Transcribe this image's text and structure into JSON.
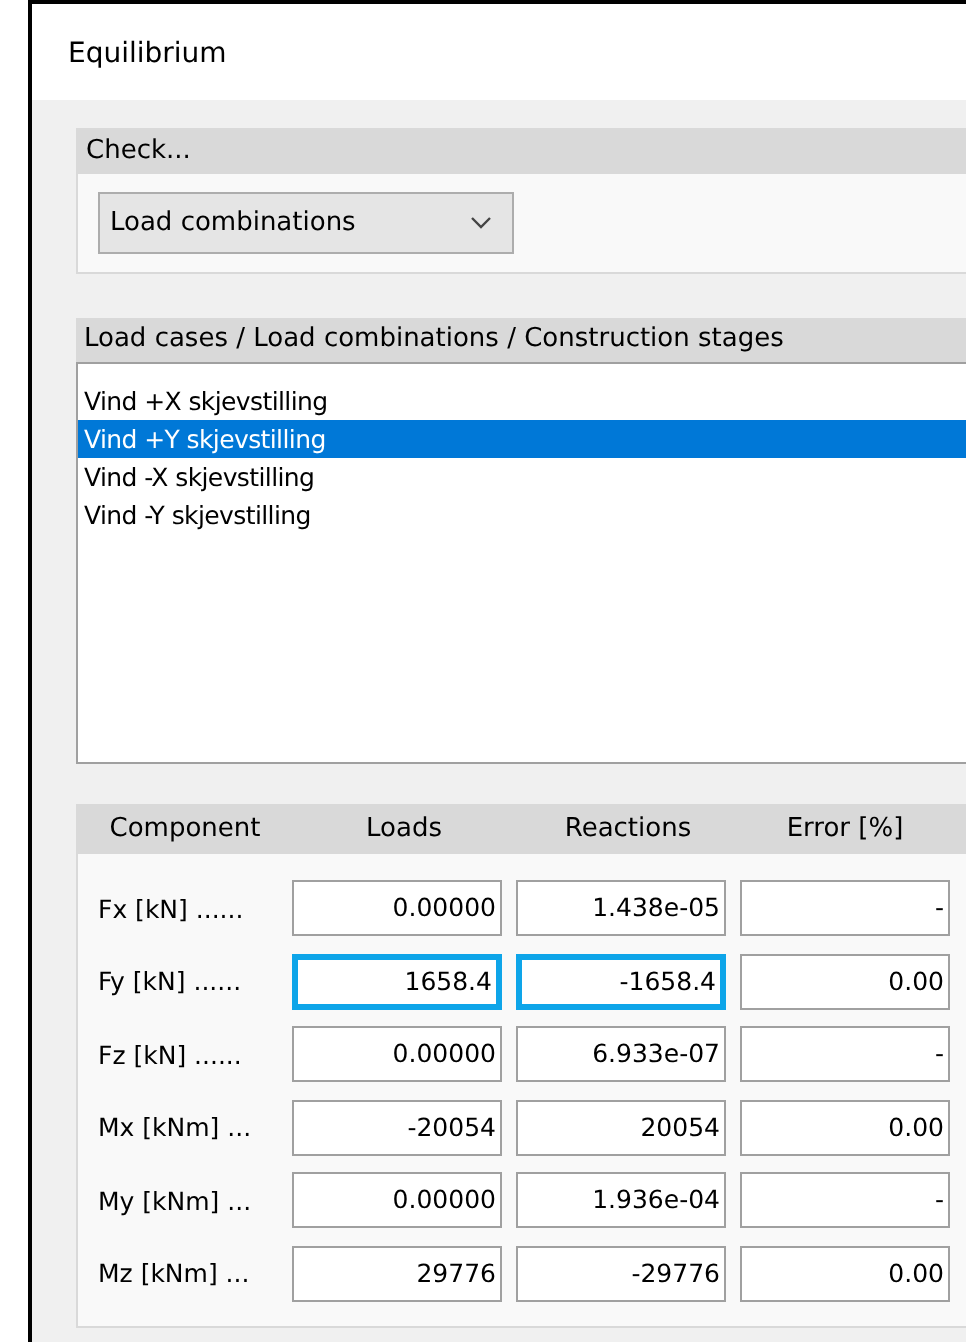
{
  "window": {
    "title": "Equilibrium"
  },
  "check": {
    "title": "Check...",
    "dropdown": {
      "value": "Load combinations"
    }
  },
  "cases": {
    "title": "Load cases / Load combinations / Construction stages",
    "items": [
      {
        "label": "Vind +X skjevstilling",
        "selected": false
      },
      {
        "label": "Vind +Y skjevstilling",
        "selected": true
      },
      {
        "label": "Vind -X skjevstilling",
        "selected": false
      },
      {
        "label": "Vind -Y skjevstilling",
        "selected": false
      }
    ]
  },
  "results": {
    "columns": [
      "Component",
      "Loads",
      "Reactions",
      "Error [%]"
    ],
    "rows": [
      {
        "cells": [
          {
            "kind": "label",
            "value": "Fx [kN] ......"
          },
          {
            "kind": "field",
            "value": "0.00000",
            "highlighted": false
          },
          {
            "kind": "field",
            "value": "1.438e-05",
            "highlighted": false
          },
          {
            "kind": "field",
            "value": "-",
            "highlighted": false
          }
        ]
      },
      {
        "cells": [
          {
            "kind": "label",
            "value": "Fy [kN] ......"
          },
          {
            "kind": "field",
            "value": "1658.4",
            "highlighted": true
          },
          {
            "kind": "field",
            "value": "-1658.4",
            "highlighted": true
          },
          {
            "kind": "field",
            "value": "0.00",
            "highlighted": false
          }
        ]
      },
      {
        "cells": [
          {
            "kind": "label",
            "value": "Fz [kN] ......"
          },
          {
            "kind": "field",
            "value": "0.00000",
            "highlighted": false
          },
          {
            "kind": "field",
            "value": "6.933e-07",
            "highlighted": false
          },
          {
            "kind": "field",
            "value": "-",
            "highlighted": false
          }
        ]
      },
      {
        "cells": [
          {
            "kind": "label",
            "value": "Mx [kNm] ..."
          },
          {
            "kind": "field",
            "value": "-20054",
            "highlighted": false
          },
          {
            "kind": "field",
            "value": "20054",
            "highlighted": false
          },
          {
            "kind": "field",
            "value": "0.00",
            "highlighted": false
          }
        ]
      },
      {
        "cells": [
          {
            "kind": "label",
            "value": "My [kNm] ..."
          },
          {
            "kind": "field",
            "value": "0.00000",
            "highlighted": false
          },
          {
            "kind": "field",
            "value": "1.936e-04",
            "highlighted": false
          },
          {
            "kind": "field",
            "value": "-",
            "highlighted": false
          }
        ]
      },
      {
        "cells": [
          {
            "kind": "label",
            "value": "Mz [kNm] ..."
          },
          {
            "kind": "field",
            "value": "29776",
            "highlighted": false
          },
          {
            "kind": "field",
            "value": "-29776",
            "highlighted": false
          },
          {
            "kind": "field",
            "value": "0.00",
            "highlighted": false
          }
        ]
      }
    ]
  }
}
